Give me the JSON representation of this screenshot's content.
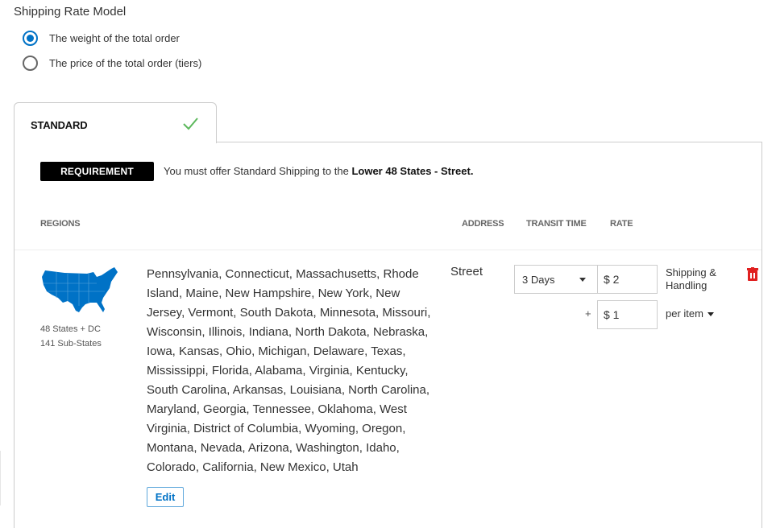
{
  "rate_model": {
    "title": "Shipping Rate Model",
    "options": [
      {
        "label": "The weight of the total order",
        "selected": true
      },
      {
        "label": "The price of the total order (tiers)",
        "selected": false
      }
    ]
  },
  "tabs": [
    {
      "label": "STANDARD",
      "status_icon": "check-icon",
      "active": true
    }
  ],
  "requirement": {
    "badge": "REQUIREMENT",
    "text_prefix": "You must offer Standard Shipping to the ",
    "text_bold": "Lower 48 States - Street."
  },
  "columns": {
    "regions": "REGIONS",
    "address": "ADDRESS",
    "transit_time": "TRANSIT TIME",
    "rate": "RATE"
  },
  "row": {
    "map_icon": "us-map-icon",
    "region_summary": "48 States + DC",
    "sub_states": "141 Sub-States",
    "states": "Pennsylvania, Connecticut, Massachusetts, Rhode Island, Maine, New Hampshire, New York, New Jersey, Vermont, South Dakota, Minnesota, Missouri, Wisconsin, Illinois, Indiana, North Dakota, Nebraska, Iowa, Kansas, Ohio, Michigan, Delaware, Texas, Mississippi, Florida, Alabama, Virginia, Kentucky, South Carolina, Arkansas, Louisiana, North Carolina, Maryland, Georgia, Tennessee, Oklahoma, West Virginia, District of Columbia, Wyoming, Oregon, Montana, Nevada, Arizona, Washington, Idaho, Colorado, California, New Mexico, Utah",
    "edit_label": "Edit",
    "address": "Street",
    "transit_time": "3 Days",
    "base_rate": "$ 2",
    "base_rate_label": "Shipping & Handling",
    "plus": "+",
    "per_item_rate": "$ 1",
    "per_item_label": "per item"
  },
  "colors": {
    "accent": "#0072c6",
    "check": "#5cb85c",
    "delete": "#e02020"
  }
}
